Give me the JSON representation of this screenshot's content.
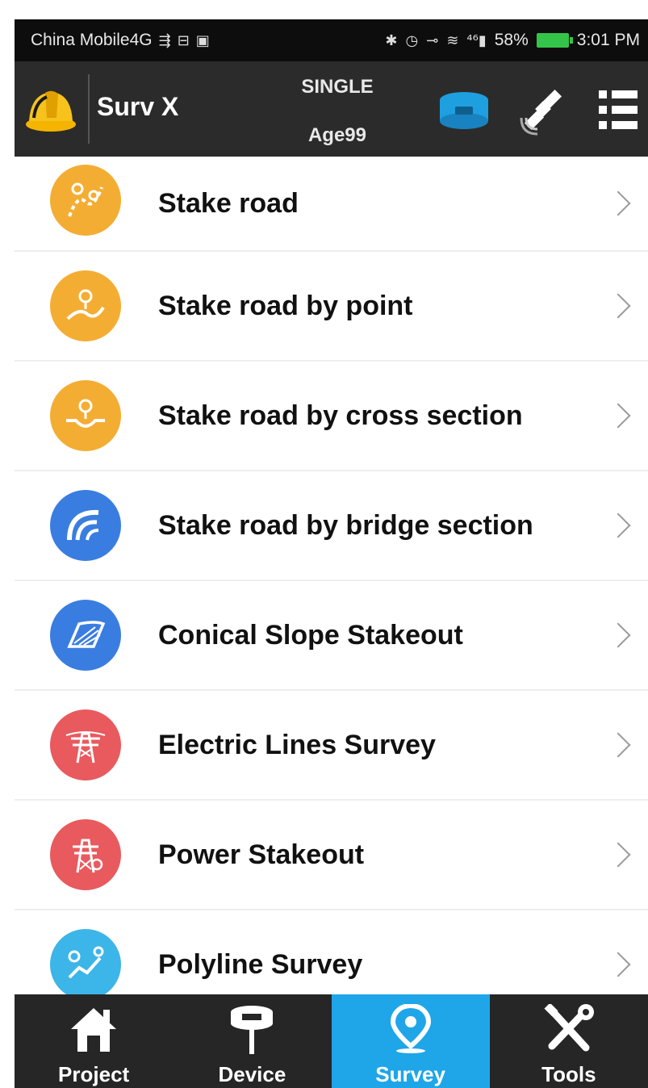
{
  "statusbar": {
    "carrier": "China Mobile4G",
    "signal_text": "⁴⁶",
    "battery": "58%",
    "time": "3:01 PM"
  },
  "appbar": {
    "title": "Surv X",
    "mode": "SINGLE",
    "age": "Age99",
    "icons": [
      "helmet-logo",
      "gnss-receiver-icon",
      "satellite-icon",
      "menu-list-icon"
    ]
  },
  "menu": {
    "items": [
      {
        "label": "Stake road",
        "color": "#f4ad33",
        "icon": "stake-road-icon"
      },
      {
        "label": "Stake road by point",
        "color": "#f4ad33",
        "icon": "stake-road-point-icon"
      },
      {
        "label": "Stake road by cross section",
        "color": "#f4ad33",
        "icon": "cross-section-icon"
      },
      {
        "label": "Stake road by bridge section",
        "color": "#3a7de0",
        "icon": "bridge-section-icon"
      },
      {
        "label": "Conical Slope Stakeout",
        "color": "#3a7de0",
        "icon": "conical-slope-icon"
      },
      {
        "label": "Electric Lines Survey",
        "color": "#e85a5e",
        "icon": "electric-lines-icon"
      },
      {
        "label": "Power Stakeout",
        "color": "#e85a5e",
        "icon": "power-tower-icon"
      },
      {
        "label": "Polyline Survey",
        "color": "#3cb5e8",
        "icon": "polyline-icon"
      }
    ]
  },
  "nav": {
    "tabs": [
      {
        "label": "Project",
        "icon": "house-icon",
        "active": false
      },
      {
        "label": "Device",
        "icon": "receiver-icon",
        "active": false
      },
      {
        "label": "Survey",
        "icon": "location-pin-icon",
        "active": true
      },
      {
        "label": "Tools",
        "icon": "tools-icon",
        "active": false
      }
    ]
  },
  "colors": {
    "appbar_bg": "#2b2b2b",
    "nav_active": "#1ea6e8",
    "orange": "#f4ad33",
    "blue": "#3a7de0",
    "red": "#e85a5e",
    "cyan": "#3cb5e8"
  }
}
